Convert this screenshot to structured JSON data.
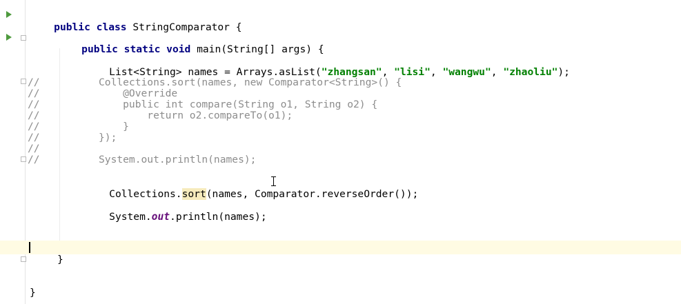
{
  "editor": {
    "language": "Java",
    "lines": {
      "class_decl": {
        "kw": "public class",
        "rest": " StringComparator {"
      },
      "main_decl": {
        "kw": "public static void",
        "rest": " main(String[] args) {"
      },
      "list_decl": {
        "prefix": "List<String> names = Arrays.asList(",
        "s1": "\"zhangsan\"",
        "s2": "\"lisi\"",
        "s3": "\"wangwu\"",
        "s4": "\"zhaoliu\"",
        "sep": ", ",
        "suffix": ");"
      },
      "comment_markers": [
        "//",
        "//",
        "//",
        "//",
        "//",
        "//",
        "//",
        "//"
      ],
      "comment_block": [
        "Collections.sort(names, new Comparator<String>() {",
        "    @Override",
        "    public int compare(String o1, String o2) {",
        "        return o2.compareTo(o1);",
        "    }",
        "});",
        "",
        "System.out.println(names);"
      ],
      "sort_call": {
        "prefix": "Collections.",
        "method": "sort",
        "suffix": "(names, Comparator.reverseOrder());"
      },
      "println_call": {
        "prefix": "System.",
        "field": "out",
        "suffix": ".println(names);"
      },
      "close_method": "}",
      "close_class": "}"
    }
  },
  "colors": {
    "keyword": "#000080",
    "string": "#008000",
    "comment": "#8c8c8c",
    "field": "#660e7a",
    "caret_line": "#fffbe3",
    "highlight": "#f6ebbc",
    "run_icon": "#4e9a3e"
  },
  "icons": {
    "run_class": "run-icon",
    "run_main": "run-icon",
    "fold": "fold-icon"
  }
}
